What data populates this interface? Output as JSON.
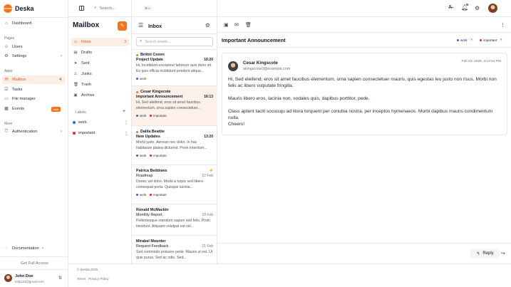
{
  "app": {
    "name": "Deska"
  },
  "topbar": {
    "search_placeholder": "Search...",
    "search_shortcut": "⌘ K"
  },
  "sidebar": {
    "top_items": [
      {
        "label": "Dashboard"
      }
    ],
    "pages_section": "Pages",
    "pages": [
      {
        "label": "Users"
      },
      {
        "label": "Settings"
      }
    ],
    "apps_section": "Apps",
    "apps": [
      {
        "label": "Mailbox",
        "count": "4"
      },
      {
        "label": "Tasks"
      },
      {
        "label": "File manager"
      },
      {
        "label": "Events",
        "badge": "new"
      }
    ],
    "more_section": "More",
    "more": [
      {
        "label": "Authentication"
      }
    ],
    "documentation": "Documentation",
    "get_full_access": "Get Full Access",
    "user": {
      "name": "John Doe",
      "email": "test123@gmail.com"
    }
  },
  "mailbox": {
    "title": "Mailbox",
    "folders": [
      {
        "label": "Inbox",
        "count": "3"
      },
      {
        "label": "Drafts"
      },
      {
        "label": "Sent"
      },
      {
        "label": "Junks"
      },
      {
        "label": "Trash"
      },
      {
        "label": "Archive"
      }
    ],
    "labels_heading": "Labels",
    "labels": [
      {
        "label": "work",
        "color": "#2563eb"
      },
      {
        "label": "important",
        "color": "#dc2626"
      }
    ]
  },
  "inbox": {
    "title": "Inbox",
    "search_placeholder": "Search emails...",
    "emails": [
      {
        "sender": "Brittni Coxen",
        "subject": "Project Update",
        "date": "16:20",
        "preview": "Hi, Incididunt excepteur laborum quis dolor sit. Ex quis officia incididunt proident aliqua...",
        "tags": [
          "work"
        ]
      },
      {
        "sender": "Cesar Kingscote",
        "subject": "Important Announcement",
        "date": "16:13",
        "preview": "Hi, Sed eleifend, eros sit amet faucibus elementum, urna sapien consectetuer...",
        "tags": [
          "work",
          "important"
        ]
      },
      {
        "sender": "Dalila Beattie",
        "subject": "New Updates",
        "date": "13:20",
        "preview": "Morbi justo. Aenean nec dolor. In hac habitasse platea dictumst. Proin interdum...",
        "tags": [
          "work",
          "important"
        ]
      },
      {
        "sender": "Patrica Beddows",
        "subject": "Roadmap",
        "date": "22 Feb",
        "preview": "Donec vel dolor. Morbi a turpis sed libero consequat porta. Quisque lacinia...",
        "tags": [
          "work",
          "important"
        ]
      },
      {
        "sender": "Ronald McMackin",
        "subject": "Monthly Report.",
        "date": "18 Feb",
        "preview": "Pellentesque interdum sapien sed felis. Proin tincidunt. Aliquam volutpat est vel...",
        "tags": []
      },
      {
        "sender": "Mirabel Mounter",
        "subject": "Request Feedback",
        "date": "21 Feb",
        "preview": "Sed commodo posuere pede. Mauris ut est. Ut quis purus. Sed ac odio. Sed...",
        "tags": []
      }
    ]
  },
  "reader": {
    "subject": "Important Announcement",
    "chips": [
      {
        "label": "work",
        "color": "#2563eb"
      },
      {
        "label": "important",
        "color": "#dc2626"
      }
    ],
    "from_name": "Cesar Kingscote",
    "from_email": "akingscote0@example.com",
    "date": "Feb 23, 2026, 4:13:54 PM",
    "paragraphs": [
      "Hi, Sed eleifend, eros sit amet faucibus elementum, urna sapien consectetuer mauris, quis egestas leo justo non risus. Morbi non felis ac libero vulputate fringilla.",
      "Mauris libero eros, lacinia non, sodales quis, dapibus porttitor, pede.",
      "Class aptent taciti sociosqu ad litora torquent per conubia nostra, per inceptos hymenaeos. Morbi dapibus mauris condimentum nulla.",
      "Cheers!"
    ],
    "reply_label": "Reply"
  },
  "footer": {
    "copyright": "© Deska 2026",
    "terms": "Terms",
    "privacy": "Privacy Policy"
  },
  "colors": {
    "accent": "#f97316"
  }
}
